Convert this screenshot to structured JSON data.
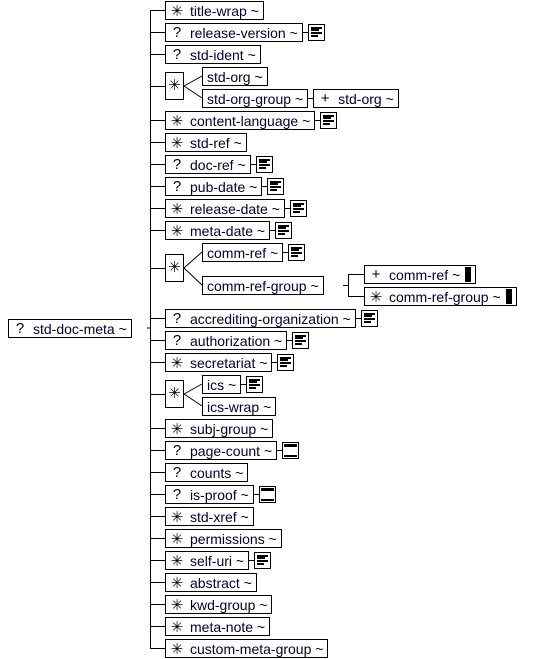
{
  "root": {
    "prefix": "?",
    "label": "std-doc-meta ~"
  },
  "children": [
    {
      "prefix": "*",
      "label": "title-wrap ~"
    },
    {
      "prefix": "?",
      "label": "release-version ~",
      "badge": "text"
    },
    {
      "prefix": "?",
      "label": "std-ident ~"
    },
    {
      "compositor": "*",
      "items": [
        {
          "label": "std-org ~"
        },
        {
          "label": "std-org-group ~",
          "next": {
            "prefix": "+",
            "label": "std-org ~"
          }
        }
      ]
    },
    {
      "prefix": "*",
      "label": "content-language ~",
      "badge": "text"
    },
    {
      "prefix": "*",
      "label": "std-ref ~"
    },
    {
      "prefix": "?",
      "label": "doc-ref ~",
      "badge": "text"
    },
    {
      "prefix": "?",
      "label": "pub-date ~",
      "badge": "text"
    },
    {
      "prefix": "*",
      "label": "release-date ~",
      "badge": "text"
    },
    {
      "prefix": "*",
      "label": "meta-date ~",
      "badge": "text"
    },
    {
      "compositor": "*",
      "items": [
        {
          "label": "comm-ref ~",
          "badge": "text"
        },
        {
          "label": "comm-ref-group ~",
          "sub": [
            {
              "prefix": "+",
              "label": "comm-ref ~",
              "bar": true
            },
            {
              "prefix": "*",
              "label": "comm-ref-group ~",
              "bar": true
            }
          ]
        }
      ]
    },
    {
      "prefix": "?",
      "label": "accrediting-organization ~",
      "badge": "text"
    },
    {
      "prefix": "?",
      "label": "authorization ~",
      "badge": "text"
    },
    {
      "prefix": "*",
      "label": "secretariat ~",
      "badge": "text"
    },
    {
      "compositor": "*",
      "items": [
        {
          "label": "ics ~",
          "badge": "text"
        },
        {
          "label": "ics-wrap ~"
        }
      ]
    },
    {
      "prefix": "*",
      "label": "subj-group ~"
    },
    {
      "prefix": "?",
      "label": "page-count ~",
      "badge": "empty"
    },
    {
      "prefix": "?",
      "label": "counts ~"
    },
    {
      "prefix": "?",
      "label": "is-proof ~",
      "badge": "empty"
    },
    {
      "prefix": "*",
      "label": "std-xref ~"
    },
    {
      "prefix": "*",
      "label": "permissions ~"
    },
    {
      "prefix": "*",
      "label": "self-uri ~",
      "badge": "text"
    },
    {
      "prefix": "*",
      "label": "abstract ~"
    },
    {
      "prefix": "*",
      "label": "kwd-group ~"
    },
    {
      "prefix": "*",
      "label": "meta-note ~"
    },
    {
      "prefix": "*",
      "label": "custom-meta-group ~"
    }
  ]
}
